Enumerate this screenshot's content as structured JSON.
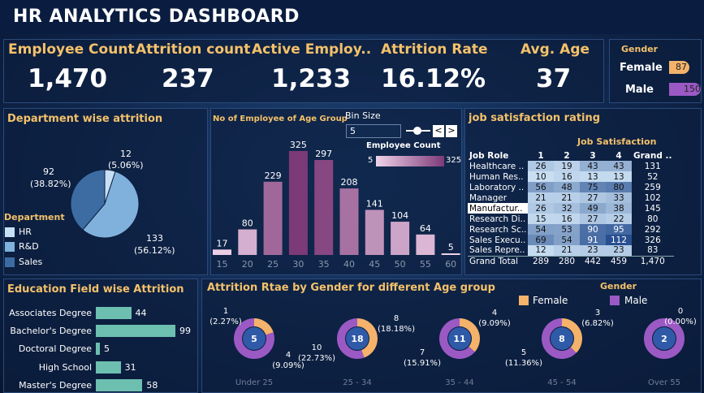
{
  "header": {
    "title": "HR ANALYTICS DASHBOARD"
  },
  "kpis": [
    {
      "label": "Employee Count",
      "value": "1,470"
    },
    {
      "label": "Attrition count",
      "value": "237"
    },
    {
      "label": "Active  Employ..",
      "value": "1,233"
    },
    {
      "label": "Attrition Rate",
      "value": "16.12%"
    },
    {
      "label": "Avg. Age",
      "value": "37"
    }
  ],
  "gender_panel": {
    "title": "Gender",
    "rows": [
      {
        "label": "Female",
        "value": 87,
        "color": "#f4b26b"
      },
      {
        "label": "Male",
        "value": 150,
        "color": "#9b59c4"
      }
    ]
  },
  "department": {
    "title": "Department wise attrition",
    "legend_title": "Department",
    "legend": [
      {
        "label": "HR",
        "color": "#c6e0f5"
      },
      {
        "label": "R&D",
        "color": "#7fb1dc"
      },
      {
        "label": "Sales",
        "color": "#3d6ca3"
      }
    ],
    "slice_labels": [
      {
        "count": "12",
        "pct": "(5.06%)"
      },
      {
        "count": "92",
        "pct": "(38.82%)"
      },
      {
        "count": "133",
        "pct": "(56.12%)"
      }
    ]
  },
  "age_group": {
    "title": "No of Employee of Age Group",
    "bin_label": "Bin Size",
    "bin_value": "5",
    "legend_title": "Employee Count",
    "legend_min": "5",
    "legend_max": "325",
    "prev": "<",
    "next": ">"
  },
  "job_sat": {
    "title": "job satisfaction rating",
    "col_group": "Job Satisfaction",
    "headers": [
      "Job Role",
      "1",
      "2",
      "3",
      "4",
      "Grand .."
    ],
    "rows": [
      {
        "role": "Healthcare ..",
        "v": [
          "26",
          "19",
          "43",
          "43"
        ],
        "total": "131"
      },
      {
        "role": "Human Res..",
        "v": [
          "10",
          "16",
          "13",
          "13"
        ],
        "total": "52"
      },
      {
        "role": "Laboratory ..",
        "v": [
          "56",
          "48",
          "75",
          "80"
        ],
        "total": "259"
      },
      {
        "role": "Manager",
        "v": [
          "21",
          "21",
          "27",
          "33"
        ],
        "total": "102"
      },
      {
        "role": "Manufactur..",
        "v": [
          "26",
          "32",
          "49",
          "38"
        ],
        "total": "145"
      },
      {
        "role": "Research Di..",
        "v": [
          "15",
          "16",
          "27",
          "22"
        ],
        "total": "80"
      },
      {
        "role": "Research Sc..",
        "v": [
          "54",
          "53",
          "90",
          "95"
        ],
        "total": "292"
      },
      {
        "role": "Sales Execu..",
        "v": [
          "69",
          "54",
          "91",
          "112"
        ],
        "total": "326"
      },
      {
        "role": "Sales Repre..",
        "v": [
          "12",
          "21",
          "23",
          "23"
        ],
        "total": "83"
      }
    ],
    "grand": {
      "label": "Grand Total",
      "v": [
        "289",
        "280",
        "442",
        "459"
      ],
      "total": "1,470"
    }
  },
  "education": {
    "title": "Education Field wise Attrition",
    "items": [
      {
        "label": "Associates Degree",
        "value": 44
      },
      {
        "label": "Bachelor's Degree",
        "value": 99
      },
      {
        "label": "Doctoral Degree",
        "value": 5
      },
      {
        "label": "High School",
        "value": 31
      },
      {
        "label": "Master's Degree",
        "value": 58
      }
    ]
  },
  "gender_age": {
    "title": "Attrition Rtae by Gender for different Age group",
    "legend_title": "Gender",
    "legend": [
      {
        "label": "Female",
        "color": "#f4b26b"
      },
      {
        "label": "Male",
        "color": "#9b59c4"
      }
    ],
    "groups": [
      {
        "label": "Under 25",
        "center": "5",
        "a": "1",
        "a_pct": "(2.27%)",
        "b": "4",
        "b_pct": "(9.09%)"
      },
      {
        "label": "25 - 34",
        "center": "18",
        "a": "8",
        "a_pct": "(18.18%)",
        "b": "10",
        "b_pct": "(22.73%)"
      },
      {
        "label": "35 - 44",
        "center": "11",
        "a": "4",
        "a_pct": "(9.09%)",
        "b": "7",
        "b_pct": "(15.91%)"
      },
      {
        "label": "45 - 54",
        "center": "8",
        "a": "3",
        "a_pct": "(6.82%)",
        "b": "5",
        "b_pct": "(11.36%)"
      },
      {
        "label": "Over 55",
        "center": "2",
        "a": "0",
        "a_pct": "(0.00%)",
        "b": "",
        "b_pct": ""
      }
    ]
  },
  "chart_data": [
    {
      "type": "pie",
      "title": "Department wise attrition",
      "categories": [
        "HR",
        "R&D",
        "Sales"
      ],
      "values": [
        12,
        133,
        92
      ],
      "percent": [
        5.06,
        56.12,
        38.82
      ]
    },
    {
      "type": "bar",
      "title": "No of Employee of Age Group",
      "categories": [
        "15",
        "20",
        "25",
        "30",
        "35",
        "40",
        "45",
        "50",
        "55",
        "60"
      ],
      "values": [
        17,
        80,
        229,
        325,
        297,
        208,
        141,
        104,
        64,
        5
      ]
    },
    {
      "type": "bar",
      "orientation": "horizontal",
      "title": "Education Field wise Attrition",
      "categories": [
        "Associates Degree",
        "Bachelor's Degree",
        "Doctoral Degree",
        "High School",
        "Master's Degree"
      ],
      "values": [
        44,
        99,
        5,
        31,
        58
      ]
    },
    {
      "type": "pie",
      "subtype": "donut",
      "title": "Attrition Rtae by Gender for different Age group",
      "categories": [
        "Under 25",
        "25 - 34",
        "35 - 44",
        "45 - 54",
        "Over 55"
      ],
      "series": [
        {
          "name": "Female",
          "values": [
            1,
            8,
            4,
            3,
            0
          ]
        },
        {
          "name": "Male",
          "values": [
            4,
            10,
            7,
            5,
            2
          ]
        }
      ],
      "totals": [
        5,
        18,
        11,
        8,
        2
      ]
    },
    {
      "type": "table",
      "title": "job satisfaction rating",
      "columns": [
        "1",
        "2",
        "3",
        "4",
        "Grand .."
      ],
      "rows": [
        "Healthcare ..",
        "Human Res..",
        "Laboratory ..",
        "Manager",
        "Manufactur..",
        "Research Di..",
        "Research Sc..",
        "Sales Execu..",
        "Sales Repre..",
        "Grand Total"
      ]
    }
  ]
}
